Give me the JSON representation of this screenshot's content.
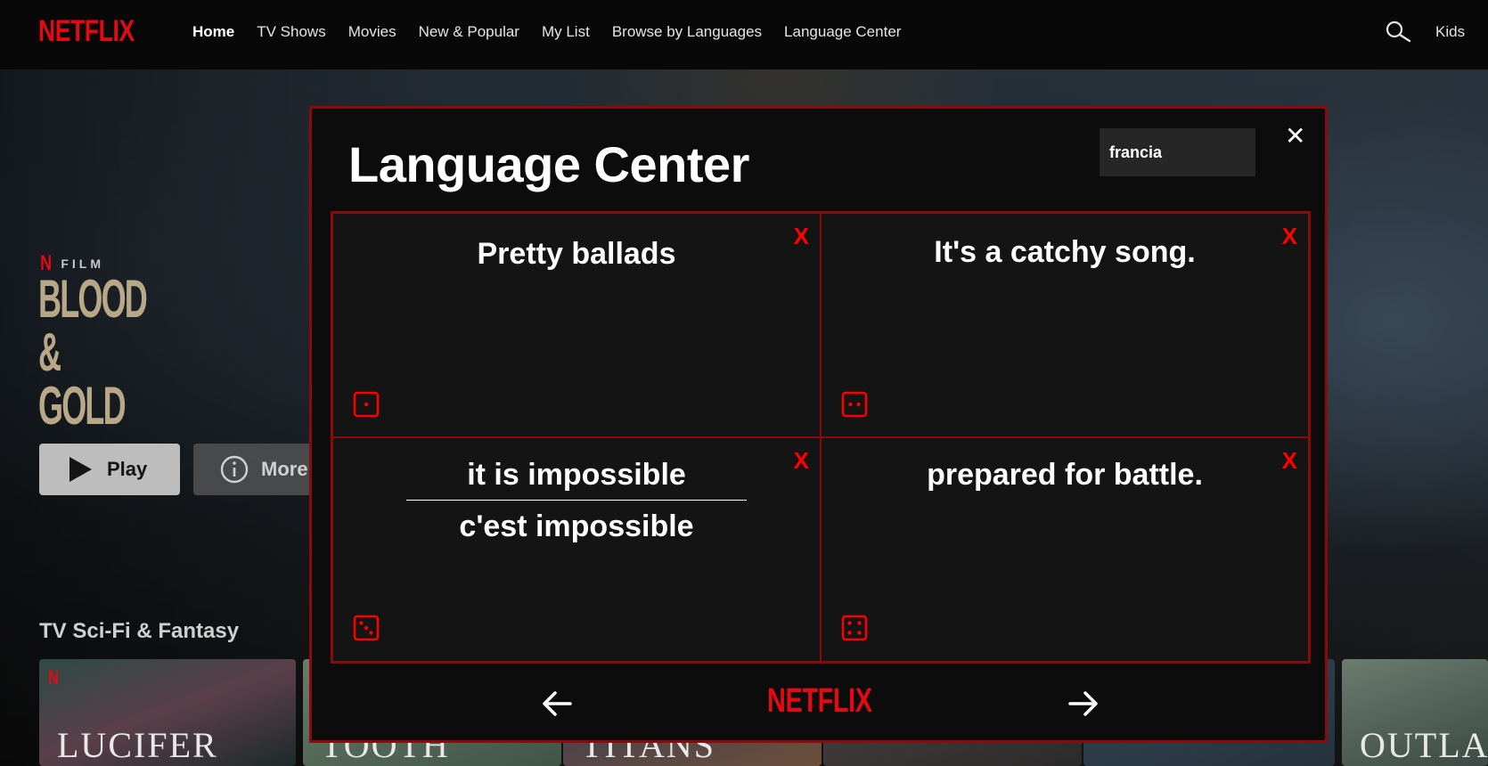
{
  "brand": {
    "logo_text": "NETFLIX",
    "accent_color": "#e50914"
  },
  "nav": {
    "items": [
      {
        "label": "Home",
        "active": true
      },
      {
        "label": "TV Shows"
      },
      {
        "label": "Movies"
      },
      {
        "label": "New & Popular"
      },
      {
        "label": "My List"
      },
      {
        "label": "Browse by Languages"
      },
      {
        "label": "Language Center"
      }
    ],
    "search_icon": "search-icon",
    "kids_label": "Kids"
  },
  "hero": {
    "film_badge": "FILM",
    "title_line1": "BLOOD",
    "title_line2": "& GOLD",
    "play_label": "Play",
    "more_label": "More Info"
  },
  "row": {
    "title": "TV Sci-Fi & Fantasy",
    "thumbnails": [
      {
        "label": "LUCIFER"
      },
      {
        "label": "SWEET TOOTH"
      },
      {
        "label": "TITANS"
      },
      {
        "label": ""
      },
      {
        "label": ""
      },
      {
        "label": "OUTLANDER"
      }
    ]
  },
  "modal": {
    "title": "Language Center",
    "language_input_value": "francia",
    "close_icon": "close-icon",
    "cards": [
      {
        "front": "Pretty ballads",
        "back": "",
        "die_face": 1
      },
      {
        "front": "It's a catchy song.",
        "back": "",
        "die_face": 2
      },
      {
        "front": "it is impossible",
        "back": "c'est impossible",
        "die_face": 3
      },
      {
        "front": "prepared for battle.",
        "back": "",
        "die_face": 4
      }
    ],
    "delete_label": "X",
    "footer_logo": "NETFLIX"
  }
}
